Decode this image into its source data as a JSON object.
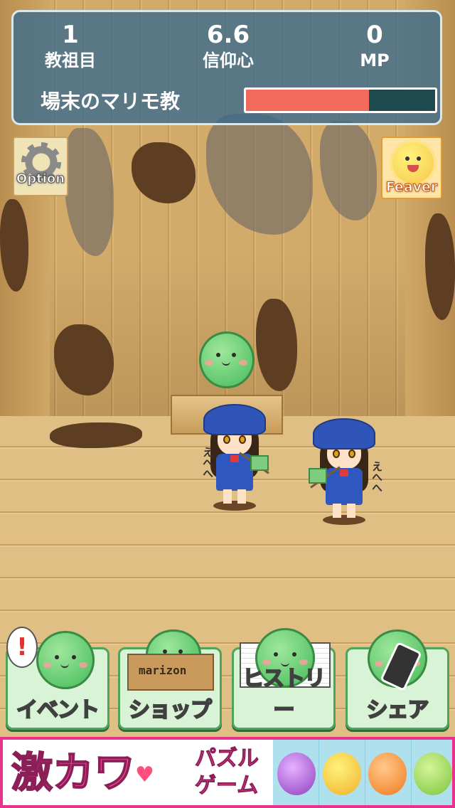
{
  "hud": {
    "generation": {
      "value": "1",
      "label": "教祖目"
    },
    "faith": {
      "value": "6.6",
      "label": "信仰心"
    },
    "mp": {
      "value": "0",
      "label": "MP"
    },
    "religion_name": "場末のマリモ教",
    "faith_bar_progress": 0.65
  },
  "corner_buttons": {
    "option_label": "Option",
    "feaver_label": "Feaver"
  },
  "scene": {
    "speech_left": "えへへ",
    "speech_right": "えへへ"
  },
  "menu": {
    "event": {
      "label": "イベント",
      "alert": "!"
    },
    "shop": {
      "label": "ショップ",
      "box_text": "marizon"
    },
    "history": {
      "label": "ヒストリー"
    },
    "share": {
      "label": "シェア"
    }
  },
  "ad_banner": {
    "headline": "激カワ",
    "heart": "♥",
    "sub_line1": "パズル",
    "sub_line2": "ゲーム"
  },
  "colors": {
    "hud_bg": "#37698c",
    "faith_bar_fill": "#f26a5c",
    "faith_bar_empty": "#1c4a4f",
    "menu_button_bg": "#d9f3d6",
    "ad_accent": "#e8328c"
  }
}
